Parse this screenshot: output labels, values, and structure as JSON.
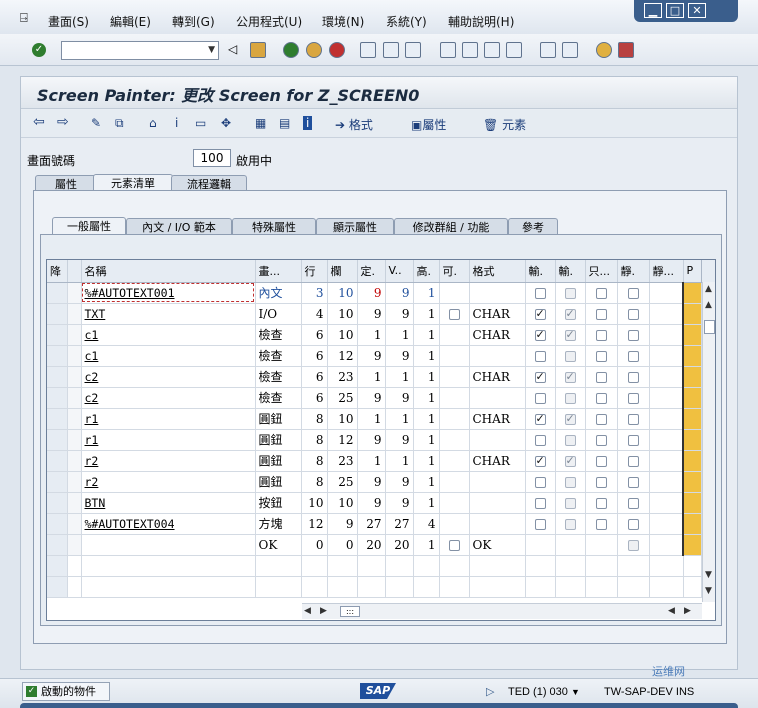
{
  "menu": [
    "畫面(S)",
    "編輯(E)",
    "轉到(G)",
    "公用程式(U)",
    "環境(N)",
    "系統(Y)",
    "輔助說明(H)"
  ],
  "window_controls": [
    "▁",
    "□",
    "✕"
  ],
  "command_field": {
    "value": ""
  },
  "title": "Screen Painter: 更改 Screen for Z_SCREEN0",
  "app_toolbar": {
    "format_label": "格式",
    "attributes_label": "屬性",
    "elements_label": "元素"
  },
  "screen": {
    "number_label": "畫面號碼",
    "number": "100",
    "status": "啟用中"
  },
  "main_tabs": [
    "屬性",
    "元素清單",
    "流程邏輯"
  ],
  "sub_tabs": [
    "一般屬性",
    "內文 / I/O 範本",
    "特殊屬性",
    "顯示屬性",
    "修改群組 / 功能",
    "參考"
  ],
  "table": {
    "headers": [
      "降",
      "名稱",
      "畫...",
      "行",
      "欄",
      "定.",
      "V..",
      "高.",
      "可.",
      "格式",
      "輸.",
      "輸.",
      "只...",
      "靜.",
      "靜...",
      "P"
    ],
    "rows": [
      {
        "name": "%#AUTOTEXT001",
        "type": "內文",
        "row": "3",
        "col": "10",
        "def": "9",
        "vis": "9",
        "h": "1",
        "can": "",
        "fmt": "",
        "in1": false,
        "in2": false,
        "ro": false,
        "st": false
      },
      {
        "name": "TXT",
        "type": "I/O",
        "row": "4",
        "col": "10",
        "def": "9",
        "vis": "9",
        "h": "1",
        "can": "cb",
        "fmt": "CHAR",
        "in1": true,
        "in2": true,
        "ro": false,
        "st": false
      },
      {
        "name": "c1",
        "type": "檢查",
        "row": "6",
        "col": "10",
        "def": "1",
        "vis": "1",
        "h": "1",
        "can": "",
        "fmt": "CHAR",
        "in1": true,
        "in2": true,
        "ro": false,
        "st": false
      },
      {
        "name": "c1",
        "type": "檢查",
        "row": "6",
        "col": "12",
        "def": "9",
        "vis": "9",
        "h": "1",
        "can": "",
        "fmt": "",
        "in1": false,
        "in2": false,
        "ro": false,
        "st": false
      },
      {
        "name": "c2",
        "type": "檢查",
        "row": "6",
        "col": "23",
        "def": "1",
        "vis": "1",
        "h": "1",
        "can": "",
        "fmt": "CHAR",
        "in1": true,
        "in2": true,
        "ro": false,
        "st": false
      },
      {
        "name": "c2",
        "type": "檢查",
        "row": "6",
        "col": "25",
        "def": "9",
        "vis": "9",
        "h": "1",
        "can": "",
        "fmt": "",
        "in1": false,
        "in2": false,
        "ro": false,
        "st": false
      },
      {
        "name": "r1",
        "type": "圓鈕",
        "row": "8",
        "col": "10",
        "def": "1",
        "vis": "1",
        "h": "1",
        "can": "",
        "fmt": "CHAR",
        "in1": true,
        "in2": true,
        "ro": false,
        "st": false
      },
      {
        "name": "r1",
        "type": "圓鈕",
        "row": "8",
        "col": "12",
        "def": "9",
        "vis": "9",
        "h": "1",
        "can": "",
        "fmt": "",
        "in1": false,
        "in2": false,
        "ro": false,
        "st": false
      },
      {
        "name": "r2",
        "type": "圓鈕",
        "row": "8",
        "col": "23",
        "def": "1",
        "vis": "1",
        "h": "1",
        "can": "",
        "fmt": "CHAR",
        "in1": true,
        "in2": true,
        "ro": false,
        "st": false
      },
      {
        "name": "r2",
        "type": "圓鈕",
        "row": "8",
        "col": "25",
        "def": "9",
        "vis": "9",
        "h": "1",
        "can": "",
        "fmt": "",
        "in1": false,
        "in2": false,
        "ro": false,
        "st": false
      },
      {
        "name": "BTN",
        "type": "按鈕",
        "row": "10",
        "col": "10",
        "def": "9",
        "vis": "9",
        "h": "1",
        "can": "",
        "fmt": "",
        "in1": false,
        "in2": false,
        "ro": false,
        "st": false
      },
      {
        "name": "%#AUTOTEXT004",
        "type": "方塊",
        "row": "12",
        "col": "9",
        "def": "27",
        "vis": "27",
        "h": "4",
        "can": "",
        "fmt": "",
        "in1": false,
        "in2": false,
        "ro": false,
        "st": false
      },
      {
        "name": "",
        "type": "OK",
        "row": "0",
        "col": "0",
        "def": "20",
        "vis": "20",
        "h": "1",
        "can": "cb",
        "fmt": "OK",
        "in1": null,
        "in2": null,
        "ro": null,
        "st": false
      }
    ]
  },
  "status": {
    "message": "啟動的物件",
    "system": "TED (1) 030",
    "host": "TW-SAP-DEV",
    "host_suffix": "INS"
  },
  "watermark": "运维网"
}
